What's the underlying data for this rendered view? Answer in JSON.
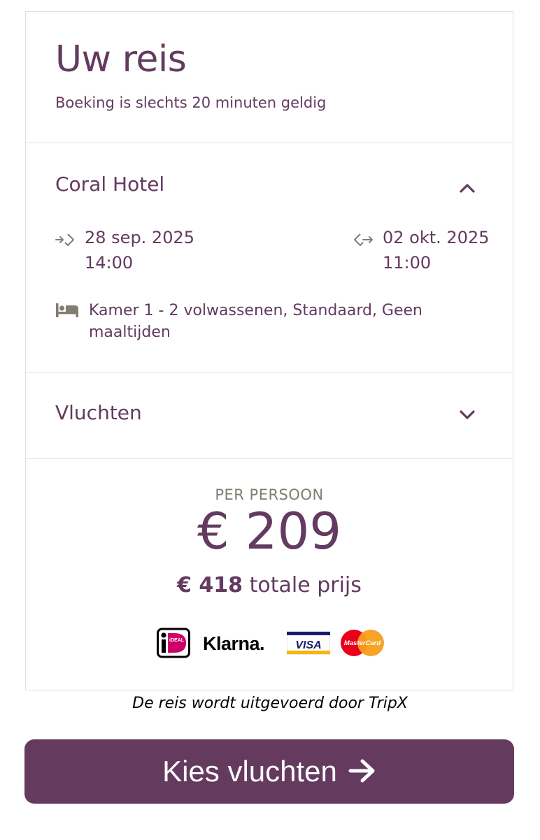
{
  "header": {
    "title": "Uw reis",
    "subtitle": "Boeking is slechts 20 minuten geldig"
  },
  "hotel": {
    "name": "Coral Hotel",
    "checkin": {
      "date": "28 sep. 2025",
      "time": "14:00"
    },
    "checkout": {
      "date": "02 okt. 2025",
      "time": "11:00"
    },
    "room": "Kamer 1  - 2 volwassenen, Standaard, Geen maaltijden",
    "expanded": true
  },
  "flights": {
    "label": "Vluchten",
    "expanded": false
  },
  "price": {
    "per_person_label": "PER PERSOON",
    "per_person_value": "€ 209",
    "total_value": "€ 418",
    "total_label": "totale prijs"
  },
  "payment_methods": [
    "iDEAL",
    "Klarna.",
    "VISA",
    "MasterCard"
  ],
  "operator_note": "De reis wordt uitgevoerd door TripX",
  "cta": {
    "label": "Kies vluchten"
  },
  "colors": {
    "brand": "#633a60",
    "button": "#653a5f",
    "muted": "#837c70",
    "border": "#e0e0e0"
  }
}
